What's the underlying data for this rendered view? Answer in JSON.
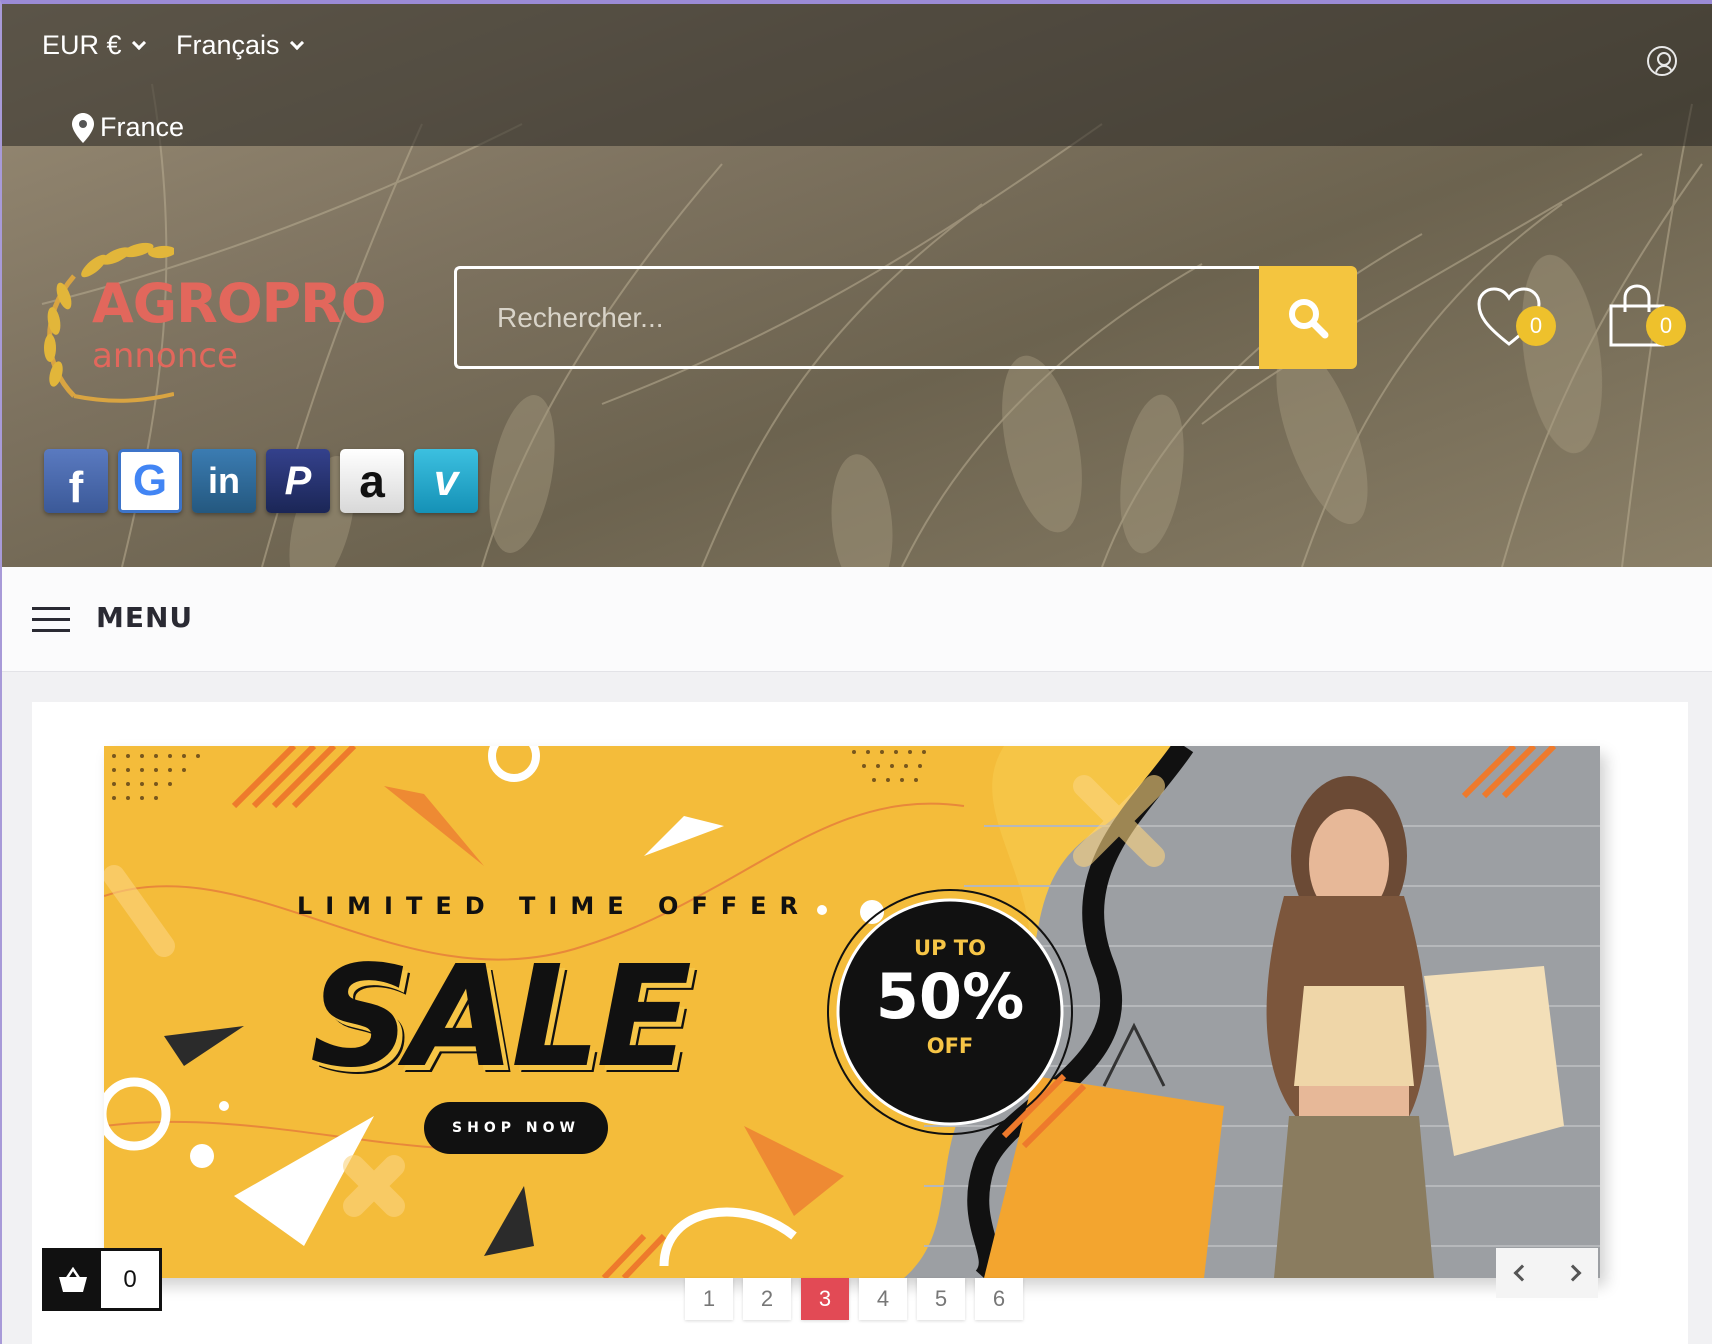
{
  "topbar": {
    "currency": "EUR €",
    "language": "Français",
    "location": "France"
  },
  "logo": {
    "name": "AGROPRO",
    "tagline": "annonce"
  },
  "search": {
    "placeholder": "Rechercher..."
  },
  "header": {
    "wishlist_count": "0",
    "cart_count": "0"
  },
  "social": [
    {
      "name": "facebook",
      "glyph": "f",
      "color": "#3b5998"
    },
    {
      "name": "google",
      "glyph": "G",
      "color": "#ffffff"
    },
    {
      "name": "linkedin",
      "glyph": "in",
      "color": "#2c6a9a"
    },
    {
      "name": "paypal",
      "glyph": "P",
      "color": "#22306b"
    },
    {
      "name": "amazon",
      "glyph": "a",
      "color": "#f1f1f1"
    },
    {
      "name": "vimeo",
      "glyph": "v",
      "color": "#1ca7cc"
    }
  ],
  "menu": {
    "label": "MENU"
  },
  "banner": {
    "headline": "LIMITED TIME OFFER",
    "title": "SALE",
    "cta": "SHOP NOW",
    "badge_top": "UP TO",
    "badge_value": "50%",
    "badge_bottom": "OFF"
  },
  "slider": {
    "pages": [
      "1",
      "2",
      "3",
      "4",
      "5",
      "6"
    ],
    "active_page": 3
  },
  "floating_cart": {
    "count": "0"
  },
  "colors": {
    "accent": "#f4c53f",
    "logo": "#e2675c",
    "active_page": "#e24a55"
  }
}
